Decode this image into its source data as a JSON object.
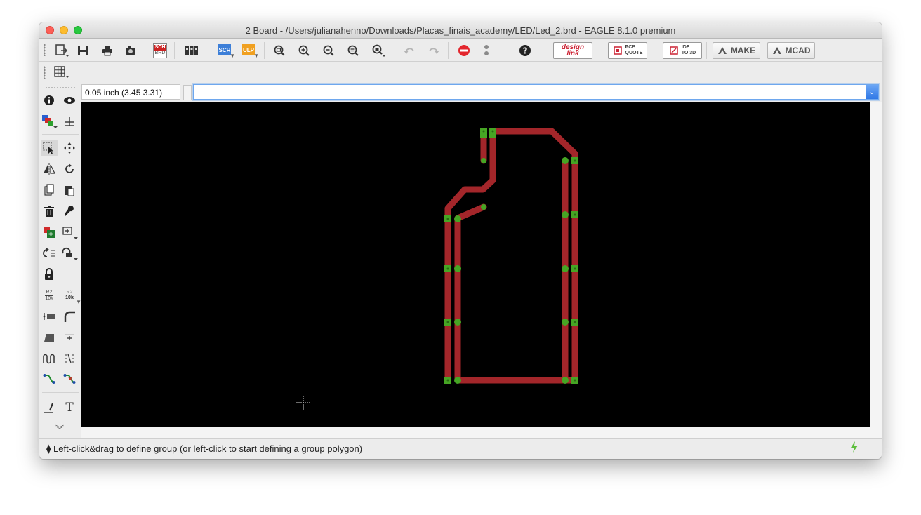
{
  "window": {
    "title": "2 Board - /Users/julianahenno/Downloads/Placas_finais_academy/LED/Led_2.brd - EAGLE 8.1.0 premium"
  },
  "toolbar": {
    "sch_brd_label_top": "SCH",
    "sch_brd_label_bottom": "BRD",
    "scr_label": "SCR",
    "ulp_label": "ULP",
    "designlink_label_1": "design",
    "designlink_label_2": "link",
    "pcb_quote_label_1": "PCB",
    "pcb_quote_label_2": "QUOTE",
    "idf_label_1": "IDF",
    "idf_label_2": "TO 3D",
    "make_label": "MAKE",
    "mcad_label": "MCAD"
  },
  "left_panel": {
    "value_label_top": "R2",
    "value_label_bottom": "10k"
  },
  "coordinates": {
    "value": "0.05 inch (3.45 3.31)"
  },
  "command": {
    "value": ""
  },
  "status": {
    "message": "⧫ Left-click&drag to define group (or left-click to start defining a group polygon)"
  },
  "colors": {
    "canvas_bg": "#000000",
    "trace": "#a3262a",
    "pad": "#46a524"
  }
}
